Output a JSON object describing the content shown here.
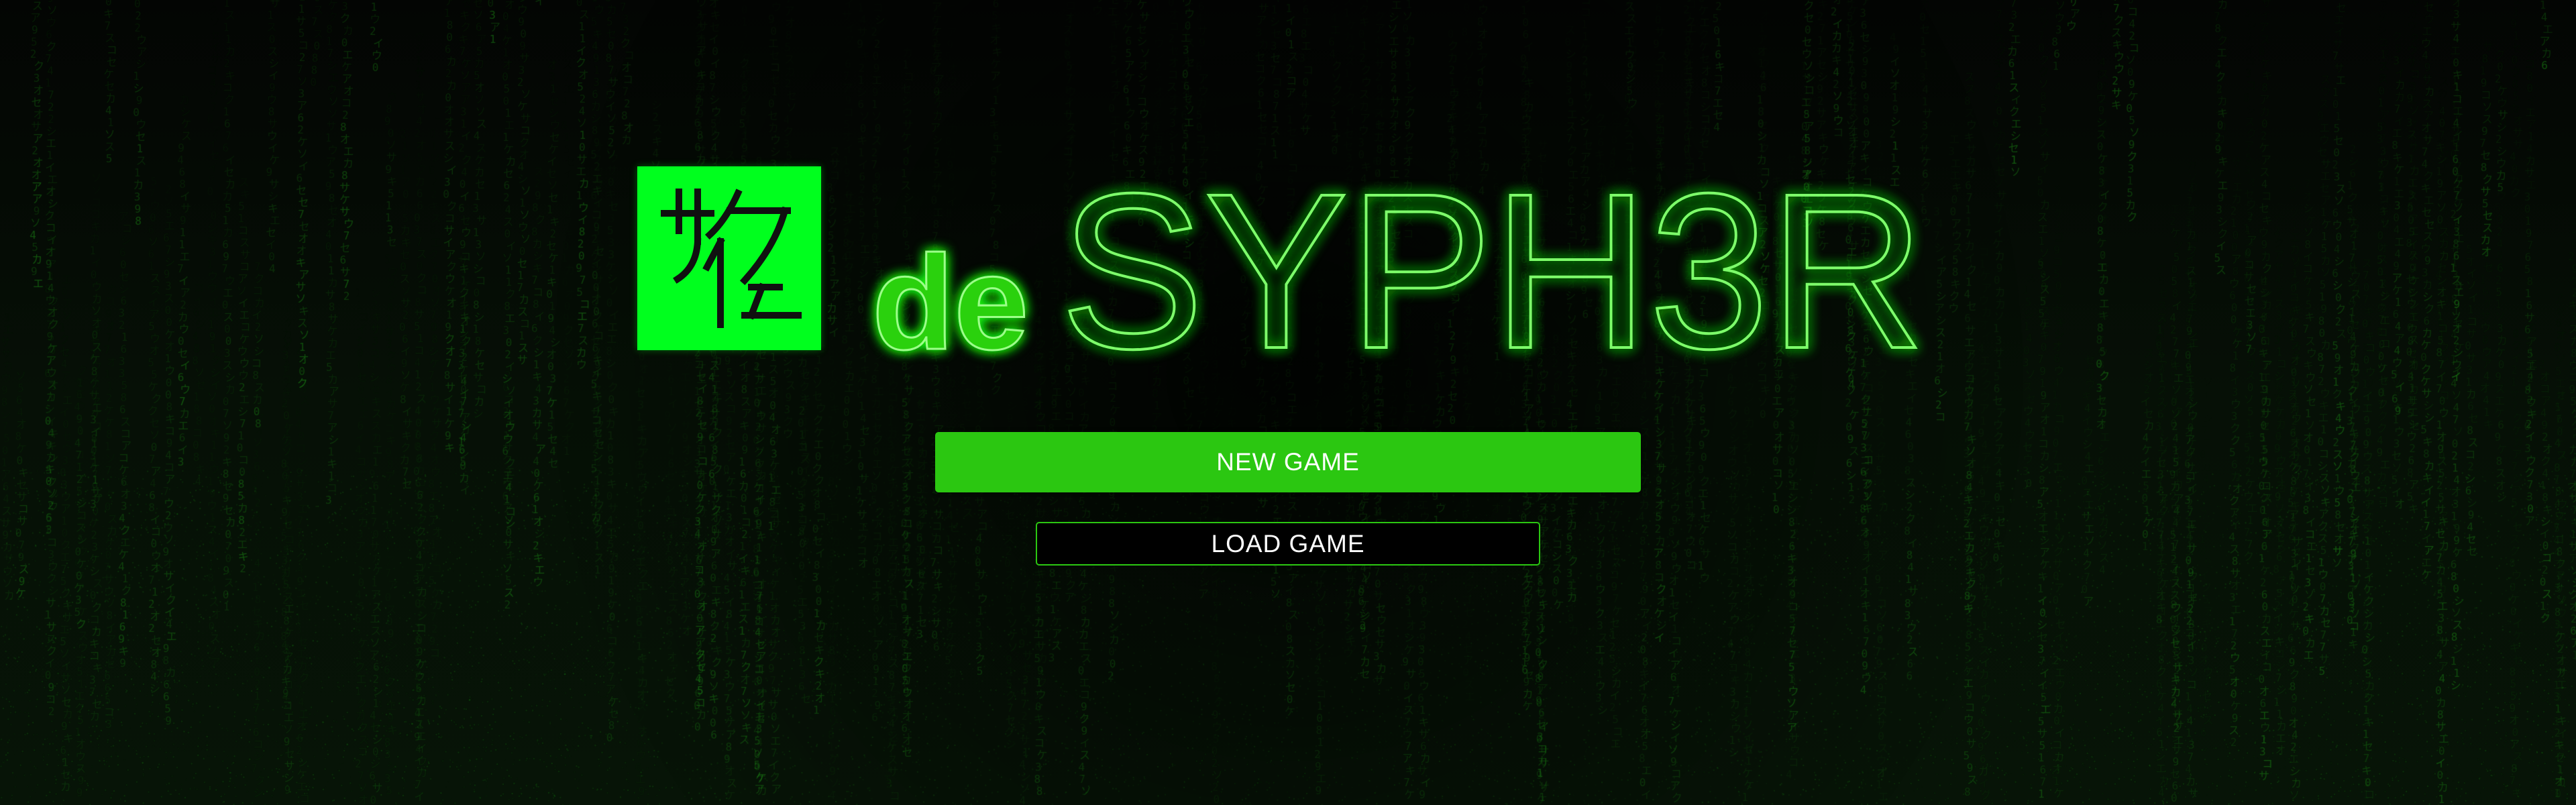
{
  "logo": {
    "glyph_icon": "katakana-monogram-icon",
    "color": "#00ff1e"
  },
  "title": {
    "prefix": "de",
    "main": "SYPH3R"
  },
  "menu": {
    "new_game_label": "NEW GAME",
    "load_game_label": "LOAD GAME"
  },
  "colors": {
    "accent": "#2bc711",
    "neon": "#7dff6a",
    "background": "#050805",
    "rain": "#1fae16"
  }
}
